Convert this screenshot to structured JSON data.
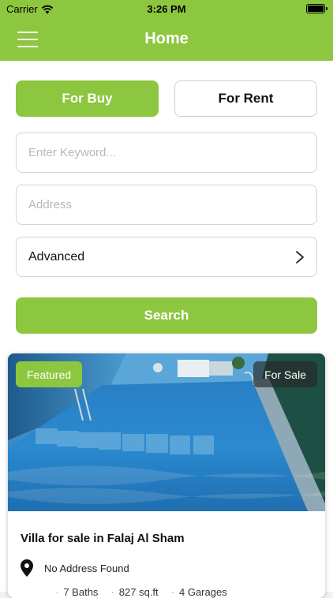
{
  "status_bar": {
    "carrier": "Carrier",
    "time": "3:26 PM"
  },
  "nav": {
    "title": "Home"
  },
  "tabs": {
    "buy": "For Buy",
    "rent": "For Rent"
  },
  "form": {
    "keyword_placeholder": "Enter Keyword...",
    "address_placeholder": "Address",
    "advanced_label": "Advanced",
    "search_label": "Search"
  },
  "listing": {
    "featured_badge": "Featured",
    "status_badge": "For Sale",
    "title": "Villa for sale in Falaj Al Sham",
    "address": "No Address Found",
    "baths": "7 Baths",
    "area": "827 sq.ft",
    "garages": "4 Garages"
  },
  "colors": {
    "accent": "#8dc63f"
  }
}
